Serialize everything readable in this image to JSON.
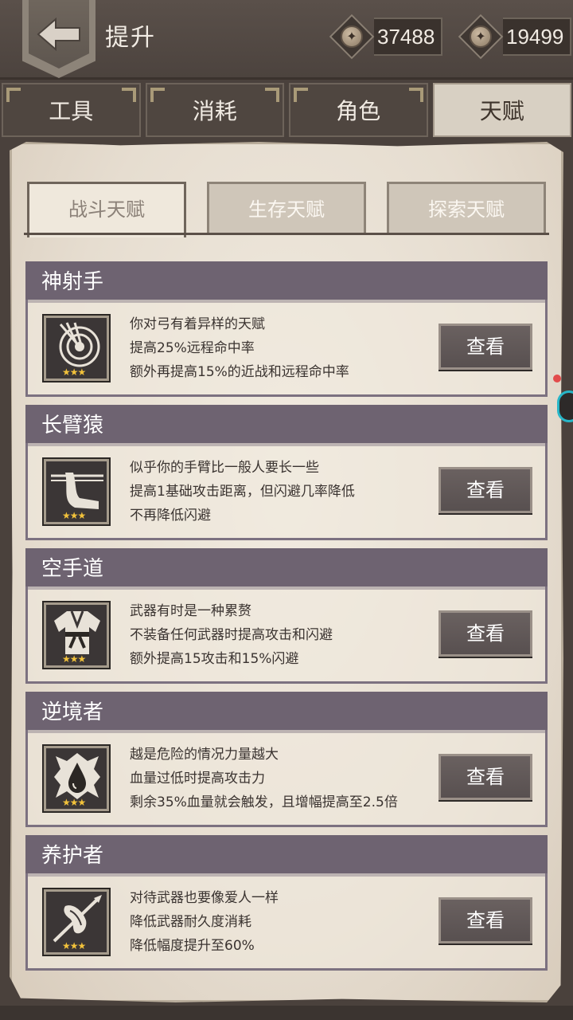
{
  "header": {
    "title": "提升",
    "currency": [
      {
        "icon": "coin-icon",
        "value": "37488"
      },
      {
        "icon": "coin-icon",
        "value": "19499"
      }
    ]
  },
  "main_tabs": [
    "工具",
    "消耗",
    "角色",
    "天赋"
  ],
  "active_main_tab": "天赋",
  "sub_tabs": [
    "战斗天赋",
    "生存天赋",
    "探索天赋"
  ],
  "active_sub_tab": "战斗天赋",
  "talents": [
    {
      "name": "神射手",
      "icon": "target-arrows-icon",
      "stars": 3,
      "lines": [
        "你对弓有着异样的天赋",
        "提高25%远程命中率",
        "额外再提高15%的近战和远程命中率"
      ],
      "button": "查看"
    },
    {
      "name": "长臂猿",
      "icon": "long-arm-icon",
      "stars": 3,
      "lines": [
        "似乎你的手臂比一般人要长一些",
        "提高1基础攻击距离，但闪避几率降低",
        "不再降低闪避"
      ],
      "button": "查看"
    },
    {
      "name": "空手道",
      "icon": "karate-gi-icon",
      "stars": 3,
      "lines": [
        "武器有时是一种累赘",
        "不装备任何武器时提高攻击和闪避",
        "额外提高15攻击和15%闪避"
      ],
      "button": "查看"
    },
    {
      "name": "逆境者",
      "icon": "blood-drop-icon",
      "stars": 3,
      "lines": [
        "越是危险的情况力量越大",
        "血量过低时提高攻击力",
        "剩余35%血量就会触发，且增幅提高至2.5倍"
      ],
      "button": "查看"
    },
    {
      "name": "养护者",
      "icon": "spear-cloth-icon",
      "stars": 3,
      "lines": [
        "对待武器也要像爱人一样",
        "降低武器耐久度消耗",
        "降低幅度提升至60%"
      ],
      "button": "查看"
    }
  ],
  "colors": {
    "header_bg": "#4c433e",
    "card_header": "#6e6371",
    "parchment": "#eae2d6",
    "star": "#f2c23b"
  }
}
